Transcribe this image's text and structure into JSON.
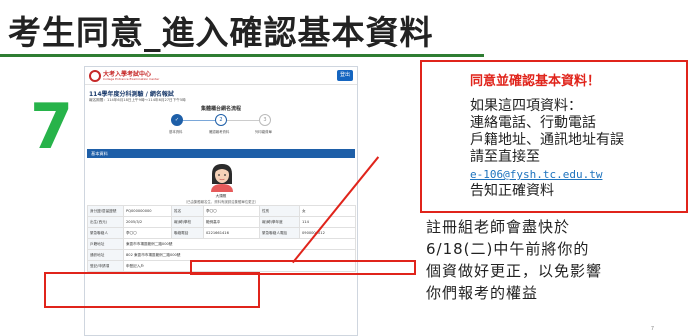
{
  "slide": {
    "title": "考生同意_進入確認基本資料",
    "step_number": "7",
    "page_number": "7"
  },
  "site": {
    "logo_text": "大考入學考試中心",
    "logo_sub": "College Entrance Examination Center",
    "login_label": "登出",
    "page_heading": "114學年度分科測驗 / 網名報試",
    "date_note": "報名期間：114年6月18日上午9時～114年6月27日下午5時",
    "steps_title": "集體櫃台網名流程",
    "steps": [
      {
        "dot": "✓",
        "label": "基本資料"
      },
      {
        "dot": "2",
        "label": "確認報考資料"
      },
      {
        "dot": "3",
        "label": "列印繳費單"
      }
    ],
    "section_title": "基本資料",
    "avatar_name": "大頭照",
    "avatar_note": "（已由集體報名生，資料有誤請洽集體單位更正）",
    "rows": [
      [
        {
          "t": "身分證/居留證號",
          "l": true
        },
        {
          "t": "PQ000000000"
        },
        {
          "t": "姓名",
          "l": true
        },
        {
          "t": "李〇〇"
        },
        {
          "t": "性別",
          "l": true
        },
        {
          "t": "女"
        }
      ],
      [
        {
          "t": "出生(西元)",
          "l": true
        },
        {
          "t": "2005/3/2"
        },
        {
          "t": "報(轉)學校",
          "l": true
        },
        {
          "t": "範例高中"
        },
        {
          "t": "報(轉)學年度",
          "l": true
        },
        {
          "t": "114"
        }
      ],
      [
        {
          "t": "緊急聯絡人",
          "l": true
        },
        {
          "t": "李〇〇"
        },
        {
          "t": "聯絡電話",
          "l": true
        },
        {
          "t": "0221661416"
        },
        {
          "t": "緊急聯絡人電話",
          "l": true
        },
        {
          "t": "0900000012"
        }
      ],
      [
        {
          "t": "戶籍地址",
          "l": true
        },
        {
          "t": "東區市市場區範例二路000號",
          "span": 5
        }
      ],
      [
        {
          "t": "通訊地址",
          "l": true
        },
        {
          "t": "802 東區市市場區範例二路000號",
          "span": 5
        }
      ],
      [
        {
          "t": "登記/申請項",
          "l": true
        },
        {
          "t": "申登記入戶",
          "span": 5
        }
      ]
    ]
  },
  "note": {
    "title": "同意並確認基本資料！",
    "lines": [
      "如果這四項資料：",
      "連絡電話、行動電話",
      "戶籍地址、通訊地址有誤",
      "請至直接至"
    ],
    "email": "e-106@fysh.tc.edu.tw",
    "last_line": "告知正確資料"
  },
  "remark": {
    "lines": [
      "註冊組老師會盡快於",
      "6/18(二)中午前將你的",
      "個資做好更正，以免影響",
      "你們報考的權益"
    ]
  },
  "colors": {
    "accent_red": "#e0241b",
    "step_green": "#27b34a",
    "rule_green": "#2e7d32",
    "site_blue": "#1e5fa8"
  }
}
